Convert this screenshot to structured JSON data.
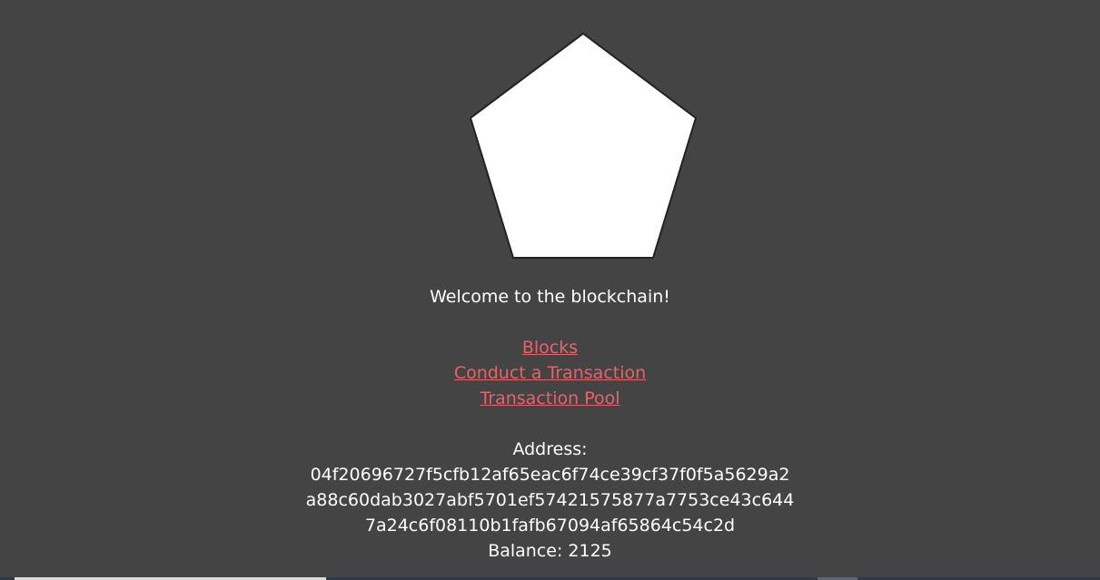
{
  "logo": {
    "icon": "pentagon-icon",
    "fill": "#ffffff",
    "stroke": "#222222"
  },
  "welcome": "Welcome to the blockchain!",
  "nav": {
    "blocks": "Blocks",
    "conduct_transaction": "Conduct a Transaction",
    "transaction_pool": "Transaction Pool"
  },
  "wallet": {
    "address_label": "Address:",
    "address_lines": [
      "04f20696727f5cfb12af65eac6f74ce39cf37f0f5a5629a2",
      "a88c60dab3027abf5701ef57421575877a7753ce43c644",
      "7a24c6f08110b1fafb67094af65864c54c2d"
    ],
    "balance_text": "Balance: 2125"
  },
  "colors": {
    "background": "#444444",
    "link": "#e8626a",
    "text": "#ffffff"
  }
}
